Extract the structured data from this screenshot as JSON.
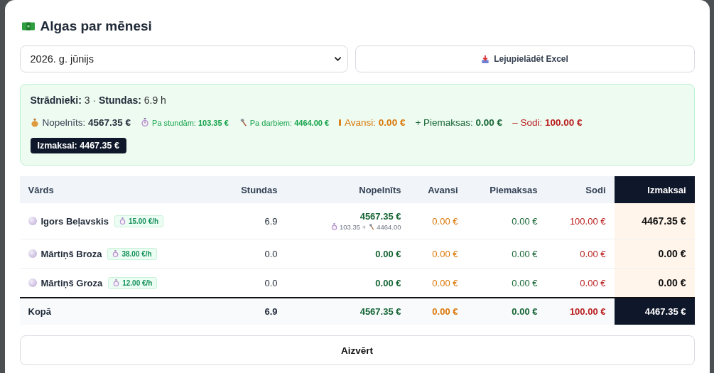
{
  "title": "Algas par mēnesi",
  "month_select": {
    "value": "2026. g. jūnijs"
  },
  "download_button": {
    "label": "Lejupielādēt Excel"
  },
  "summary": {
    "workers_label": "Strādnieki:",
    "workers": "3",
    "separator": "·",
    "hours_label": "Stundas:",
    "hours": "6.9 h",
    "items": [
      {
        "kind": "earned",
        "label": "Nopelnīts:",
        "value": "4567.35 €",
        "color": "#1f2937"
      },
      {
        "kind": "hourly",
        "label": "Pa stundām:",
        "value": "103.35 €",
        "color": "#16a34a"
      },
      {
        "kind": "piece",
        "label": "Pa darbiem:",
        "value": "4464.00 €",
        "color": "#16a34a"
      },
      {
        "kind": "advance",
        "label": "Avansi:",
        "value": "0.00 €",
        "color": "#d97706"
      },
      {
        "kind": "bonus",
        "label": "+ Piemaksas:",
        "value": "0.00 €",
        "color": "#166534"
      },
      {
        "kind": "penalty",
        "label": "– Sodi:",
        "value": "100.00 €",
        "color": "#b91c1c"
      }
    ],
    "payout": "Izmaksai: 4467.35 €"
  },
  "table": {
    "columns": [
      "Vārds",
      "Stundas",
      "Nopelnīts",
      "Avansi",
      "Piemaksas",
      "Sodi",
      "Izmaksai"
    ],
    "rows": [
      {
        "name": "Igors Beļavskis",
        "rate": "15.00 €/h",
        "hours": "6.9",
        "earned": "4567.35 €",
        "hourly_part": "103.35 +",
        "piece_part": "4464.00",
        "advances": "0.00 €",
        "bonuses": "0.00 €",
        "penalties": "100.00 €",
        "payout": "4467.35 €"
      },
      {
        "name": "Mārtiņš Broza",
        "rate": "38.00 €/h",
        "hours": "0.0",
        "earned": "0.00 €",
        "advances": "0.00 €",
        "bonuses": "0.00 €",
        "penalties": "0.00 €",
        "payout": "0.00 €"
      },
      {
        "name": "Mārtiņš Groza",
        "rate": "12.00 €/h",
        "hours": "0.0",
        "earned": "0.00 €",
        "advances": "0.00 €",
        "bonuses": "0.00 €",
        "penalties": "0.00 €",
        "payout": "0.00 €"
      }
    ],
    "total": {
      "label": "Kopā",
      "hours": "6.9",
      "earned": "4567.35 €",
      "advances": "0.00 €",
      "bonuses": "0.00 €",
      "penalties": "100.00 €",
      "payout": "4467.35 €"
    }
  },
  "close_button": {
    "label": "Aizvērt"
  }
}
